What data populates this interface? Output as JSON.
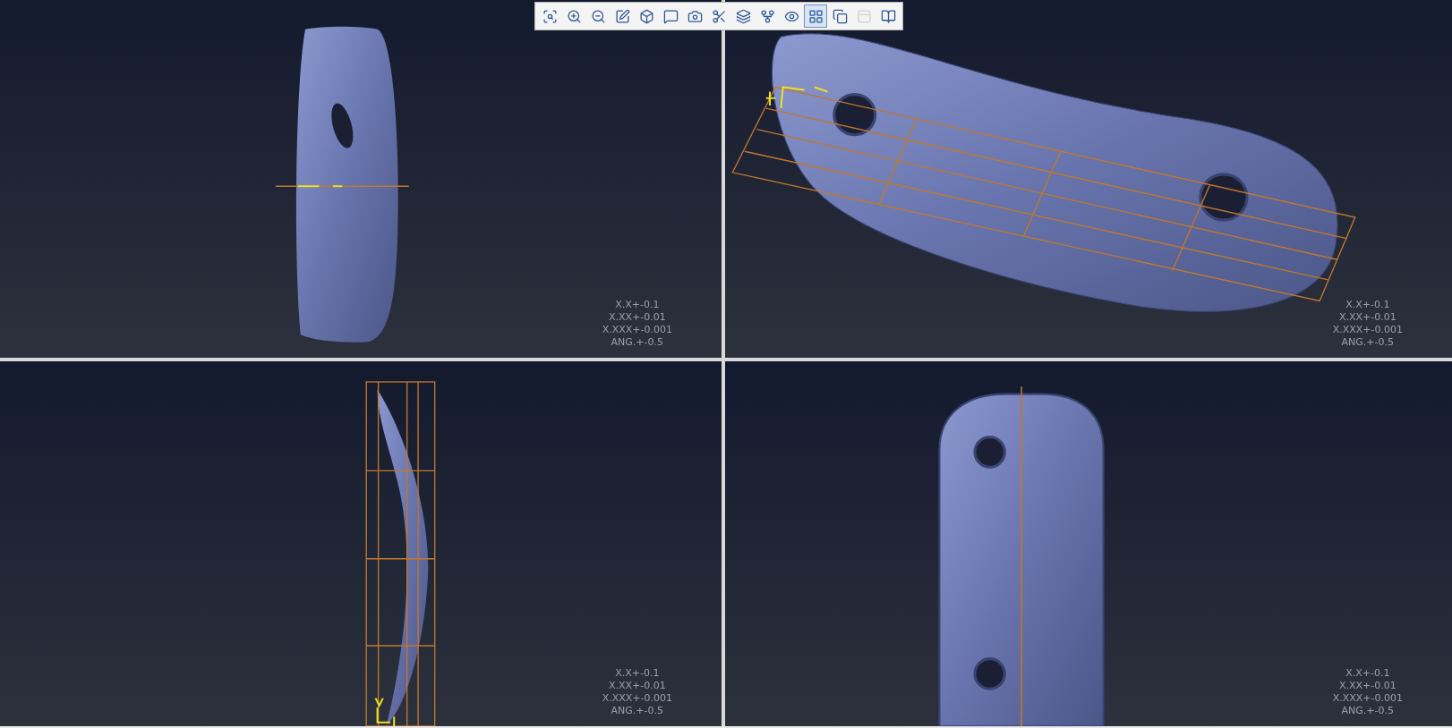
{
  "toolbar": {
    "buttons": [
      {
        "selected": false,
        "disabled": false
      },
      {
        "selected": false,
        "disabled": false
      },
      {
        "selected": false,
        "disabled": false
      },
      {
        "selected": false,
        "disabled": false
      },
      {
        "selected": false,
        "disabled": false
      },
      {
        "selected": false,
        "disabled": false
      },
      {
        "selected": false,
        "disabled": false
      },
      {
        "selected": false,
        "disabled": false
      },
      {
        "selected": false,
        "disabled": false
      },
      {
        "selected": false,
        "disabled": false
      },
      {
        "selected": false,
        "disabled": false
      },
      {
        "selected": true,
        "disabled": false
      },
      {
        "selected": false,
        "disabled": false
      },
      {
        "selected": false,
        "disabled": true
      },
      {
        "selected": false,
        "disabled": false
      }
    ]
  },
  "viewports": [
    {
      "kind": "edge",
      "tolerances": [
        "X.X+-0.1",
        "X.XX+-0.01",
        "X.XXX+-0.001",
        "ANG.+-0.5"
      ]
    },
    {
      "kind": "iso",
      "tolerances": [
        "X.X+-0.1",
        "X.XX+-0.01",
        "X.XXX+-0.001",
        "ANG.+-0.5"
      ]
    },
    {
      "kind": "side",
      "tolerances": [
        "X.X+-0.1",
        "X.XX+-0.01",
        "X.XXX+-0.001",
        "ANG.+-0.5"
      ]
    },
    {
      "kind": "plan",
      "tolerances": [
        "X.X+-0.1",
        "X.XX+-0.01",
        "X.XXX+-0.001",
        "ANG.+-0.5"
      ]
    }
  ]
}
